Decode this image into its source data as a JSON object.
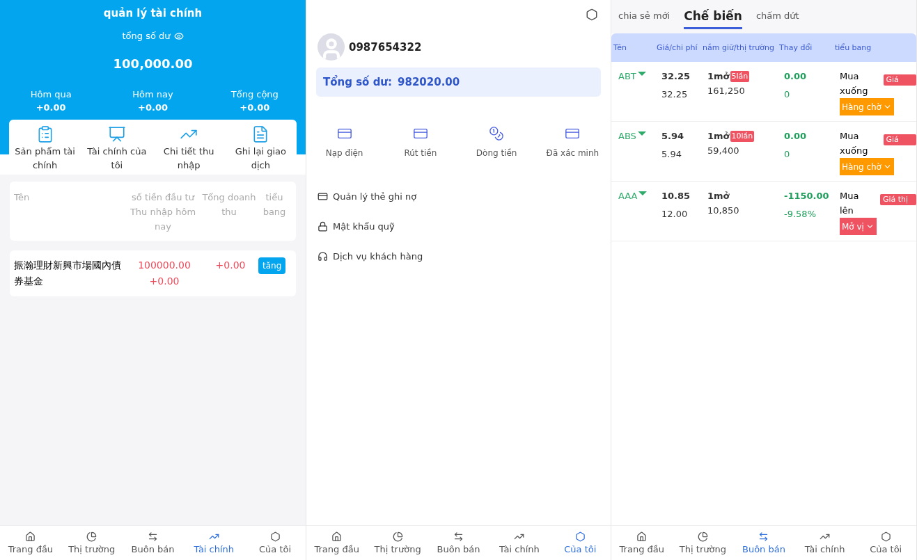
{
  "finance": {
    "title": "quản lý tài chính",
    "balance_label": "tổng số dư",
    "balance": "100,000.00",
    "stats": [
      {
        "label": "Hôm qua",
        "value": "+0.00"
      },
      {
        "label": "Hôm nay",
        "value": "+0.00"
      },
      {
        "label": "Tổng cộng",
        "value": "+0.00"
      }
    ],
    "shortcuts": [
      {
        "kind": "list",
        "label": "Sản phẩm tài chính"
      },
      {
        "kind": "board",
        "label": "Tài chính của tôi"
      },
      {
        "kind": "trend",
        "label": "Chi tiết thu nhập"
      },
      {
        "kind": "doc",
        "label": "Ghi lại giao dịch"
      }
    ],
    "table": {
      "columns": [
        "Tên",
        "số tiền đầu tư Thu nhập hôm nay",
        "Tổng doanh thu",
        "tiểu bang"
      ],
      "rows": [
        {
          "name": "振瀚理財新興市場國內債券基金",
          "amount": "100000.00",
          "today": "+0.00",
          "revenue": "+0.00",
          "action": "tăng"
        }
      ]
    },
    "nav": [
      {
        "label": "Trang đầu",
        "selected": false
      },
      {
        "label": "Thị trường",
        "selected": false
      },
      {
        "label": "Buôn bán",
        "selected": false
      },
      {
        "label": "Tài chính",
        "selected": true
      },
      {
        "label": "Của tôi",
        "selected": false
      }
    ]
  },
  "account": {
    "phone": "0987654322",
    "balance_label": "Tổng số dư:",
    "balance": "982020.00",
    "actions": [
      {
        "kind": "card",
        "label": "Nạp điện"
      },
      {
        "kind": "card-plus",
        "label": "Rút tiền"
      },
      {
        "kind": "coins",
        "label": "Dòng tiền"
      },
      {
        "kind": "card",
        "label": "Đã xác minh"
      }
    ],
    "menu": [
      {
        "kind": "card",
        "label": "Quản lý thẻ ghi nợ"
      },
      {
        "kind": "lock",
        "label": "Mật khẩu quỹ"
      },
      {
        "kind": "headset",
        "label": "Dịch vụ khách hàng"
      }
    ],
    "nav": [
      {
        "label": "Trang đầu",
        "selected": false
      },
      {
        "label": "Thị trường",
        "selected": false
      },
      {
        "label": "Buôn bán",
        "selected": false
      },
      {
        "label": "Tài chính",
        "selected": false
      },
      {
        "label": "Của tôi",
        "selected": true
      }
    ]
  },
  "trade": {
    "tabs": [
      {
        "label": "chia sẻ mới",
        "selected": false
      },
      {
        "label": "Chế biến",
        "selected": true
      },
      {
        "label": "chấm dứt",
        "selected": false
      }
    ],
    "columns": [
      "Tên",
      "Giá/chi phí",
      "nắm giữ/thị trường",
      "Thay đổi",
      "tiểu bang"
    ],
    "rows": [
      {
        "name": "ABT",
        "price": "32.25",
        "cost": "32.25",
        "hold": "1mở",
        "times": "5lần",
        "market": "161,250",
        "change": "0.00",
        "change_sub": "0",
        "direction": "Mua xuống",
        "tag": "Giá",
        "status": "Hàng chờ",
        "kind": "pending"
      },
      {
        "name": "ABS",
        "price": "5.94",
        "cost": "5.94",
        "hold": "1mở",
        "times": "10lần",
        "market": "59,400",
        "change": "0.00",
        "change_sub": "0",
        "direction": "Mua xuống",
        "tag": "Giá",
        "status": "Hàng chờ",
        "kind": "pending"
      },
      {
        "name": "AAA",
        "price": "10.85",
        "cost": "12.00",
        "hold": "1mở",
        "market": "10,850",
        "change": "-1150.00",
        "change_sub": "-9.58%",
        "direction": "Mua lên",
        "tag": "Giá thị",
        "status": "Mở vị",
        "kind": "open"
      }
    ],
    "nav": [
      {
        "label": "Trang đầu",
        "selected": false
      },
      {
        "label": "Thị trường",
        "selected": false
      },
      {
        "label": "Buôn bán",
        "selected": true
      },
      {
        "label": "Tài chính",
        "selected": false
      },
      {
        "label": "Của tôi",
        "selected": false
      }
    ]
  }
}
